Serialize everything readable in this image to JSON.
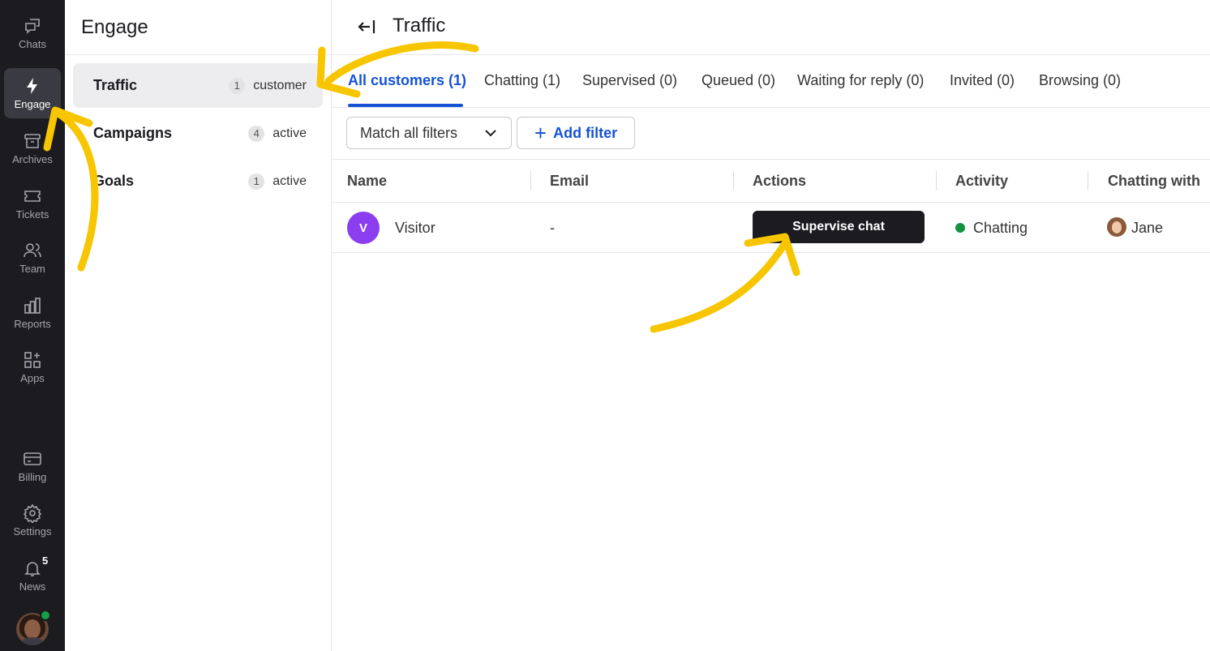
{
  "rail": {
    "items": [
      {
        "label": "Chats",
        "icon": "chats-icon"
      },
      {
        "label": "Engage",
        "icon": "lightning-icon"
      },
      {
        "label": "Archives",
        "icon": "archive-icon"
      },
      {
        "label": "Tickets",
        "icon": "ticket-icon"
      },
      {
        "label": "Team",
        "icon": "team-icon"
      },
      {
        "label": "Reports",
        "icon": "bar-chart-icon"
      },
      {
        "label": "Apps",
        "icon": "apps-icon"
      },
      {
        "label": "Billing",
        "icon": "credit-card-icon"
      },
      {
        "label": "Settings",
        "icon": "gear-icon"
      },
      {
        "label": "News",
        "icon": "bell-icon",
        "badge": "5"
      }
    ],
    "active": "Engage"
  },
  "middle": {
    "title": "Engage",
    "items": [
      {
        "label": "Traffic",
        "count": "1",
        "sub": "customer"
      },
      {
        "label": "Campaigns",
        "count": "4",
        "sub": "active"
      },
      {
        "label": "Goals",
        "count": "1",
        "sub": "active"
      }
    ]
  },
  "main": {
    "title": "Traffic",
    "tabs": [
      {
        "label": "All customers (1)"
      },
      {
        "label": "Chatting (1)"
      },
      {
        "label": "Supervised (0)"
      },
      {
        "label": "Queued (0)"
      },
      {
        "label": "Waiting for reply (0)"
      },
      {
        "label": "Invited (0)"
      },
      {
        "label": "Browsing (0)"
      }
    ],
    "filter_dropdown": "Match all filters",
    "add_filter": "Add filter",
    "columns": [
      "Name",
      "Email",
      "Actions",
      "Activity",
      "Chatting with"
    ],
    "rows": [
      {
        "initial": "V",
        "name": "Visitor",
        "email": "-",
        "action": "Supervise chat",
        "activity": "Chatting",
        "chatting_with": "Jane"
      }
    ]
  },
  "colors": {
    "rail_bg": "#1b1b20",
    "accent": "#1452d6",
    "visitor_avatar": "#8a3ef0",
    "status_chatting": "#15923f",
    "annotation": "#f7c600"
  }
}
